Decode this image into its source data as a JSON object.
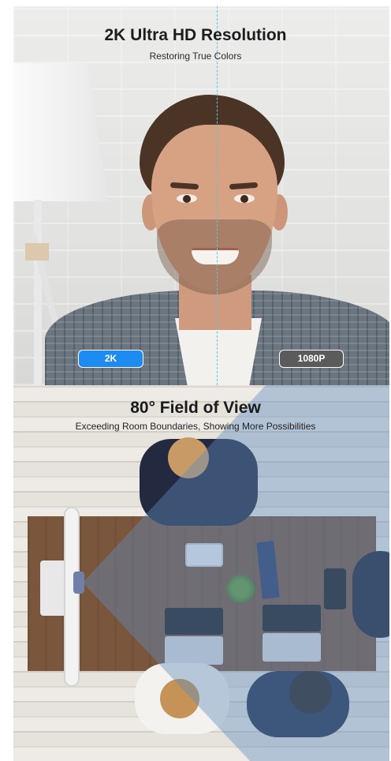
{
  "section_resolution": {
    "title": "2K Ultra HD Resolution",
    "subtitle": "Restoring True Colors",
    "badge_left": "2K",
    "badge_right": "1080P",
    "badge_left_color": "#1e8bf0",
    "badge_right_color": "#5b5b5b",
    "divider_color": "#56c8e6"
  },
  "section_fov": {
    "title": "80° Field of View",
    "subtitle": "Exceeding Room Boundaries, Showing More Possibilities",
    "fov_overlay_color": "#5f8cbe"
  }
}
